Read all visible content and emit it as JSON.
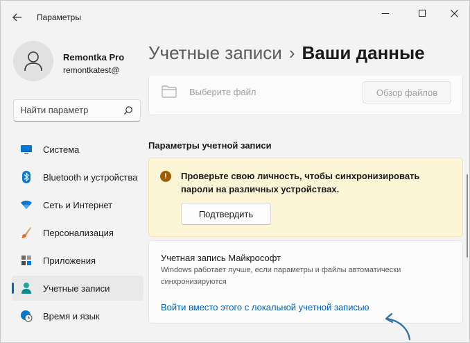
{
  "window": {
    "title": "Параметры"
  },
  "user": {
    "name": "Remontka Pro",
    "email": "remontkatest@"
  },
  "search": {
    "placeholder": "Найти параметр"
  },
  "sidebar": {
    "items": [
      {
        "label": "Система",
        "icon": "monitor-icon",
        "active": false
      },
      {
        "label": "Bluetooth и устройства",
        "icon": "bluetooth-icon",
        "active": false
      },
      {
        "label": "Сеть и Интернет",
        "icon": "wifi-icon",
        "active": false
      },
      {
        "label": "Персонализация",
        "icon": "brush-icon",
        "active": false
      },
      {
        "label": "Приложения",
        "icon": "apps-icon",
        "active": false
      },
      {
        "label": "Учетные записи",
        "icon": "accounts-icon",
        "active": true
      },
      {
        "label": "Время и язык",
        "icon": "clock-globe-icon",
        "active": false
      }
    ]
  },
  "breadcrumb": {
    "parent": "Учетные записи",
    "separator": "›",
    "current": "Ваши данные"
  },
  "file_card": {
    "label": "Выберите файл",
    "browse_button": "Обзор файлов"
  },
  "section": {
    "title": "Параметры учетной записи"
  },
  "warning_card": {
    "text": "Проверьте свою личность, чтобы синхронизировать пароли на различных устройствах.",
    "confirm_button": "Подтвердить"
  },
  "ms_card": {
    "title": "Учетная запись Майкрософт",
    "description": "Windows работает лучше, если параметры и файлы автоматически синхронизируются",
    "link": "Войти вместо этого с локальной учетной записью"
  },
  "colors": {
    "accent": "#0067c0",
    "link": "#005fb8",
    "warning_bg": "#fcf5d6",
    "warning_icon": "#9d5d00",
    "annotation_arrow": "#2a6fa8"
  }
}
